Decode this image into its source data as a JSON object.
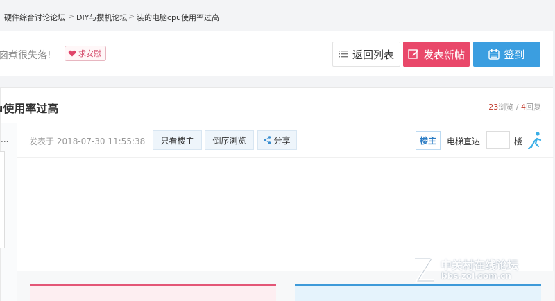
{
  "breadcrumb": {
    "items": [
      "硬件综合讨论论坛",
      "DIY与攒机论坛",
      "装的电脑cpu使用率过高"
    ],
    "separator": ">"
  },
  "toolbar": {
    "mood_text": "囱煮很失落!",
    "comfort_label": "求安慰",
    "back_label": "返回列表",
    "post_label": "发表新帖",
    "sign_label": "签到"
  },
  "thread": {
    "title": "u使用率过高",
    "views": "23",
    "views_label": "浏览",
    "stat_sep": " / ",
    "replies": "4",
    "replies_label": "回复",
    "left_dots": "...",
    "meta": "发表于 2018-07-30 11:55:38",
    "only_owner": "只看楼主",
    "reverse": "倒序浏览",
    "share": "分享",
    "owner_badge": "楼主",
    "elevator_label": "电梯直达",
    "floor_value": "",
    "floor_suffix": "楼"
  },
  "watermark": {
    "name": "中关村在线论坛",
    "url": "bbs.zol.com.cn"
  },
  "colors": {
    "accent_pink": "#e9486a",
    "accent_blue": "#3b9ee0",
    "stat_red": "#c0392b"
  }
}
